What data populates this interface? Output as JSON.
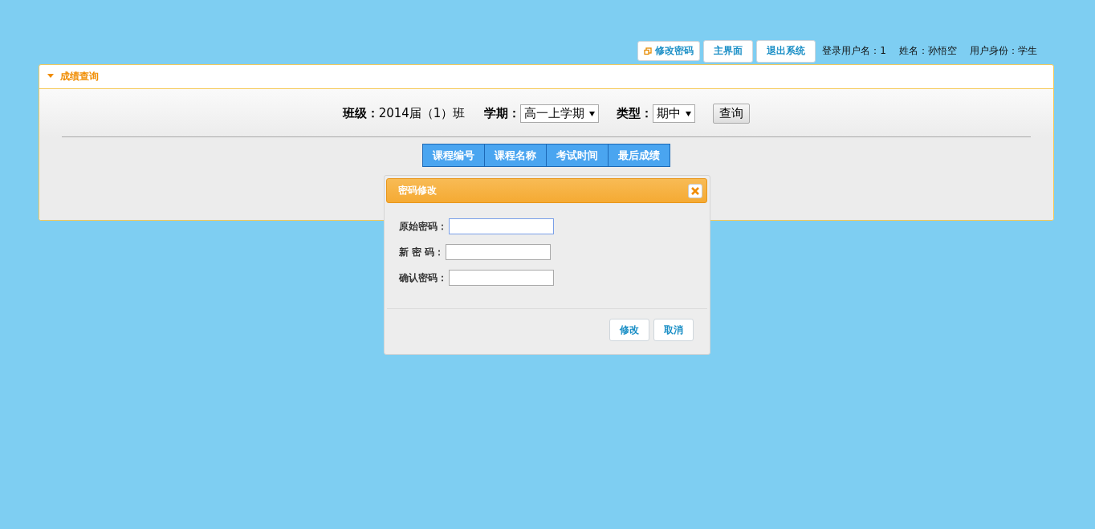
{
  "toolbar": {
    "buttons": [
      {
        "label": "修改密码",
        "kind": "icon"
      },
      {
        "label": "主界面",
        "kind": "plain"
      },
      {
        "label": "退出系统",
        "kind": "plain"
      }
    ],
    "user_info": [
      "登录用户名：1",
      "姓名：孙悟空",
      "用户身份：学生"
    ]
  },
  "panel": {
    "title": "成绩查询",
    "expanded": true,
    "filters": [
      {
        "kind": "text",
        "label": "班级：",
        "value": "2014届（1）班"
      },
      {
        "kind": "select",
        "label": "学期：",
        "value": "高一上学期"
      },
      {
        "kind": "select",
        "label": "类型：",
        "value": "期中"
      }
    ],
    "query_button": "查询",
    "table": {
      "columns": [
        "课程编号",
        "课程名称",
        "考试时间",
        "最后成绩"
      ]
    }
  },
  "dialog": {
    "title": "密码修改",
    "fields": [
      {
        "label": "原始密码：",
        "focused": true
      },
      {
        "label": "新 密 码：",
        "focused": false
      },
      {
        "label": "确认密码：",
        "focused": false
      }
    ],
    "buttons": [
      "修改",
      "取消"
    ]
  }
}
